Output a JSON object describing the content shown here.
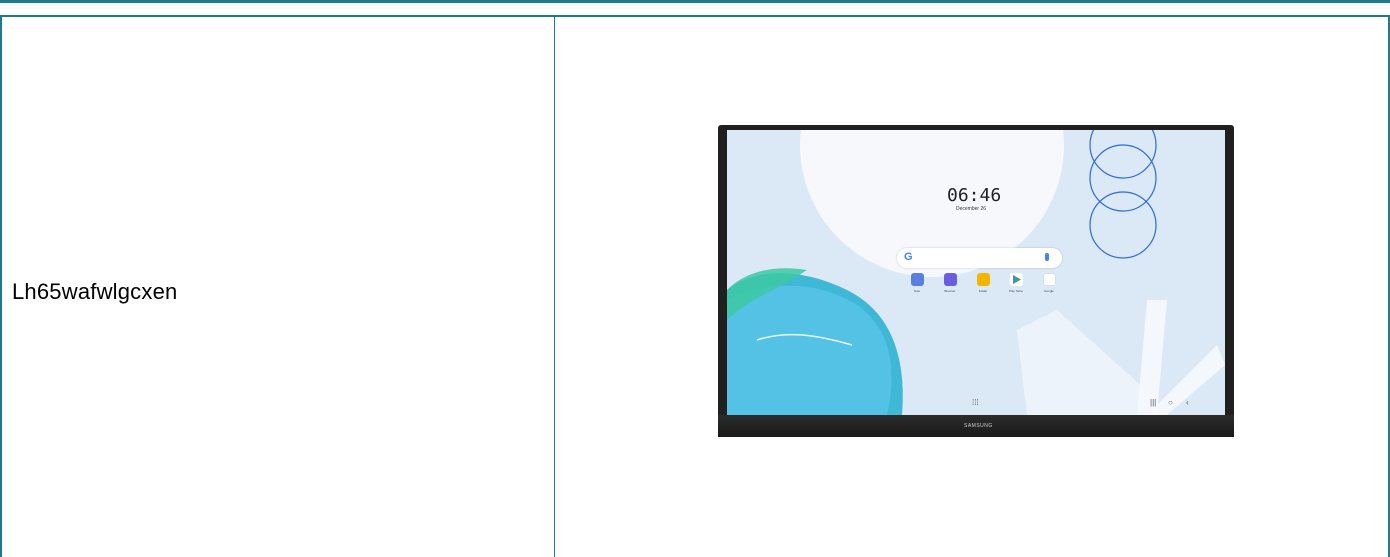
{
  "product": {
    "code": "Lh65wafwlgcxen"
  },
  "device": {
    "brand": "SAMSUNG",
    "clock_time": "06:46",
    "clock_date": "December 26",
    "apps": [
      {
        "label": "Note",
        "color": "#5b7fe0"
      },
      {
        "label": "Browser",
        "color": "#6a5de0"
      },
      {
        "label": "Folder",
        "color": "#f2b600"
      },
      {
        "label": "Play Store",
        "color": "#ffffff"
      },
      {
        "label": "Google",
        "color": "#ffffff"
      }
    ]
  },
  "colors": {
    "border": "#1f7a8c"
  }
}
